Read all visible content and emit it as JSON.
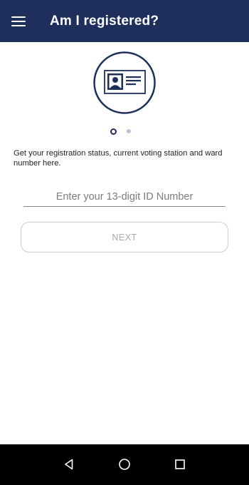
{
  "app_bar": {
    "title": "Am I registered?",
    "menu_icon": "hamburger-menu-icon",
    "background": "#1e2f5c"
  },
  "illustration": {
    "icon": "id-card-icon"
  },
  "pager": {
    "active_page": 1,
    "total_pages": 2
  },
  "description": "Get your registration status, current voting station and ward number here.",
  "id_input": {
    "placeholder": "Enter your 13-digit ID Number",
    "value": ""
  },
  "next_button": {
    "label": "NEXT"
  },
  "system_nav": {
    "back_icon": "back-triangle-icon",
    "home_icon": "home-circle-icon",
    "recents_icon": "recents-square-icon"
  }
}
